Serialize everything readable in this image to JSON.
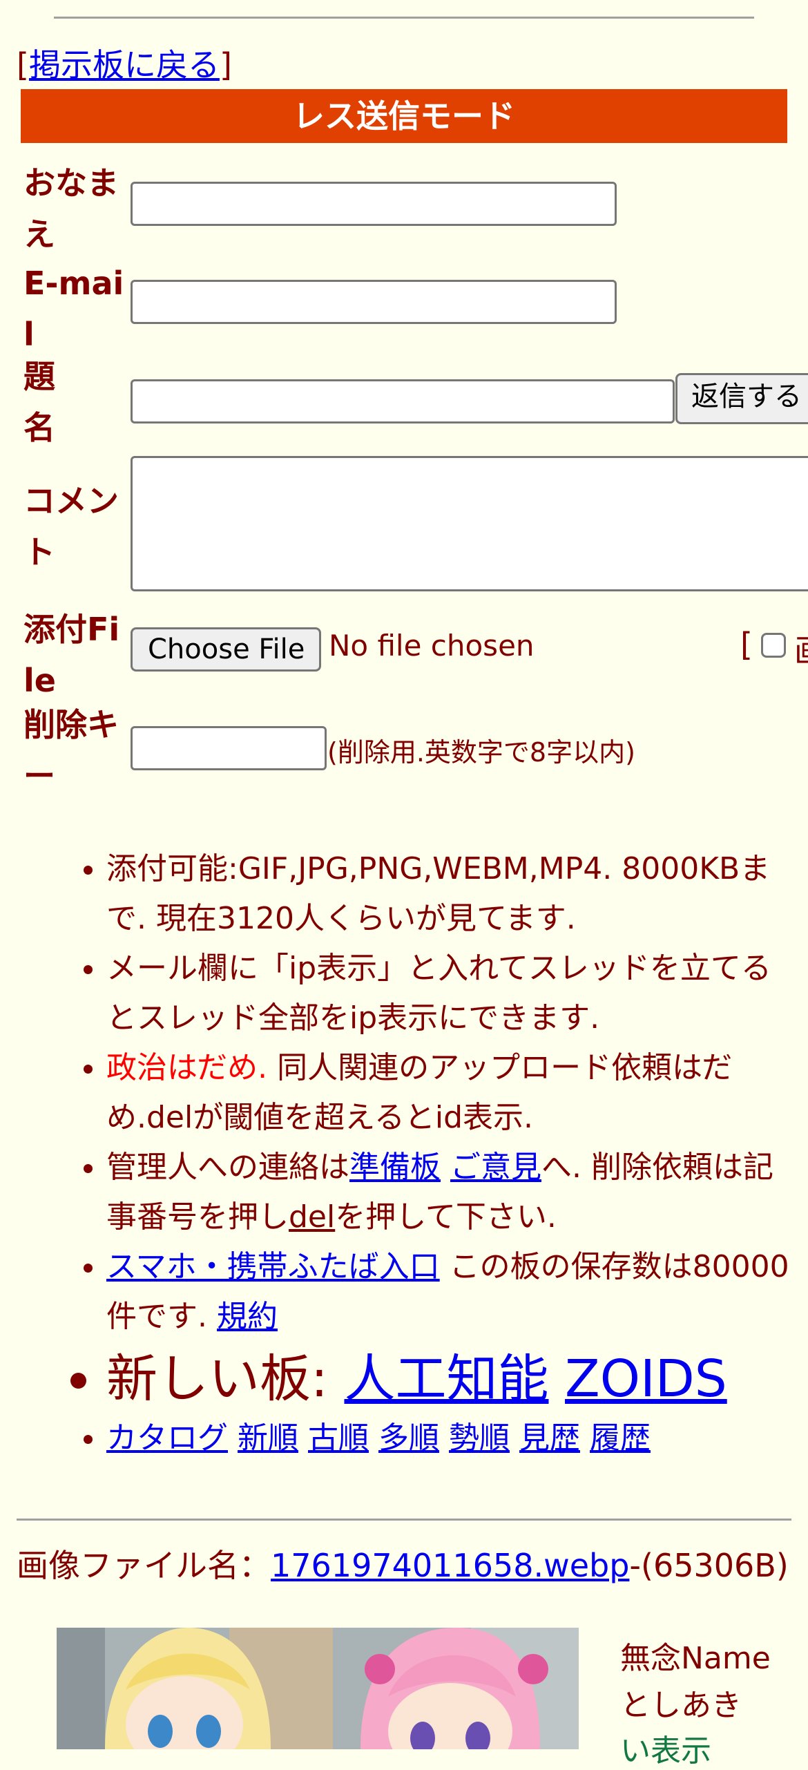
{
  "nav": {
    "back_open": "[",
    "back_label": "掲示板に戻る",
    "back_close": "]"
  },
  "form": {
    "mode_title": "レス送信モード",
    "name_label": "おなまえ",
    "email_label": "E-mail",
    "subject_label": "題名",
    "submit_label": "返信する",
    "comment_label": "コメント",
    "file_label": "添付File",
    "choose_file_label": "Choose File",
    "no_file_text": "No file chosen",
    "image_check_prefix": "[",
    "image_check_label": "画",
    "delkey_label": "削除キー",
    "delkey_note": "(削除用.英数字で8字以内)"
  },
  "notes": {
    "n1": "添付可能:GIF,JPG,PNG,WEBM,MP4. 8000KBまで. 現在3120人くらいが見てます.",
    "n2": "メール欄に「ip表示」と入れてスレッドを立てるとスレッド全部をip表示にできます.",
    "n3_red": "政治はだめ.",
    "n3_rest": " 同人関連のアップロード依頼はだめ.delが閾値を超えるとid表示.",
    "n4_a": "管理人への連絡は",
    "n4_link1": "準備板",
    "n4_sp": " ",
    "n4_link2": "ご意見",
    "n4_b": "へ. 削除依頼は記事番号を押し",
    "n4_link3": "del",
    "n4_c": "を押して下さい.",
    "n5_link": "スマホ・携帯ふたば入口",
    "n5_text": " この板の保存数は80000件です. ",
    "n5_link2": "規約",
    "n6_prefix": "新しい板: ",
    "n6_link1": "人工知能",
    "n6_link2": "ZOIDS",
    "links": [
      "カタログ",
      "新順",
      "古順",
      "多順",
      "勢順",
      "見歴",
      "履歴"
    ]
  },
  "post": {
    "file_prefix": "画像ファイル名：",
    "file_name": "1761974011658.webp",
    "file_size": "-(65306B)",
    "name_line1": "無念Name",
    "name_line2": "としあき",
    "name_line3": "い表示"
  },
  "colors": {
    "background": "#ffffee",
    "text": "#800000",
    "mode_bar": "#e04000",
    "link": "#0000ee",
    "red_note": "#ff0000"
  }
}
